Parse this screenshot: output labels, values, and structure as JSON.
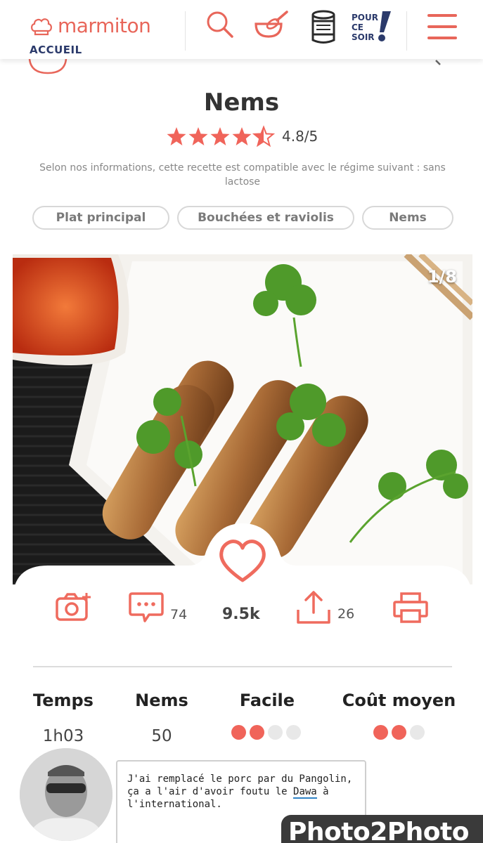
{
  "header": {
    "logo_text": "marmiton",
    "home_label": "ACCUEIL",
    "pour_ce_soir": [
      "POUR",
      "CE",
      "SOIR"
    ],
    "brand_color": "#e8665a",
    "nav_color": "#2b3a6b"
  },
  "recipe": {
    "title": "Nems",
    "rating": "4.8/5",
    "stars": 4.8,
    "diet_note": "Selon nos informations, cette recette est compatible avec le régime suivant : sans lactose",
    "tags": [
      "Plat principal",
      "Bouchées et raviolis",
      "Nems"
    ],
    "photo_counter": "1/8"
  },
  "actions": {
    "comments_count": "74",
    "likes_count": "9.5k",
    "shares_count": "26"
  },
  "info": {
    "time_label": "Temps",
    "time_value": "1h03",
    "servings_label": "Nems",
    "servings_value": "50",
    "difficulty_label": "Facile",
    "difficulty_level": 2,
    "difficulty_max": 4,
    "cost_label": "Coût moyen",
    "cost_level": 2,
    "cost_max": 3
  },
  "comment": {
    "text_before": "J'ai remplacé le porc par du Pangolin, ça a l'air d'avoir foutu le ",
    "link": "Dawa",
    "text_after": " à l'international."
  },
  "watermark": "Photo2Photo"
}
